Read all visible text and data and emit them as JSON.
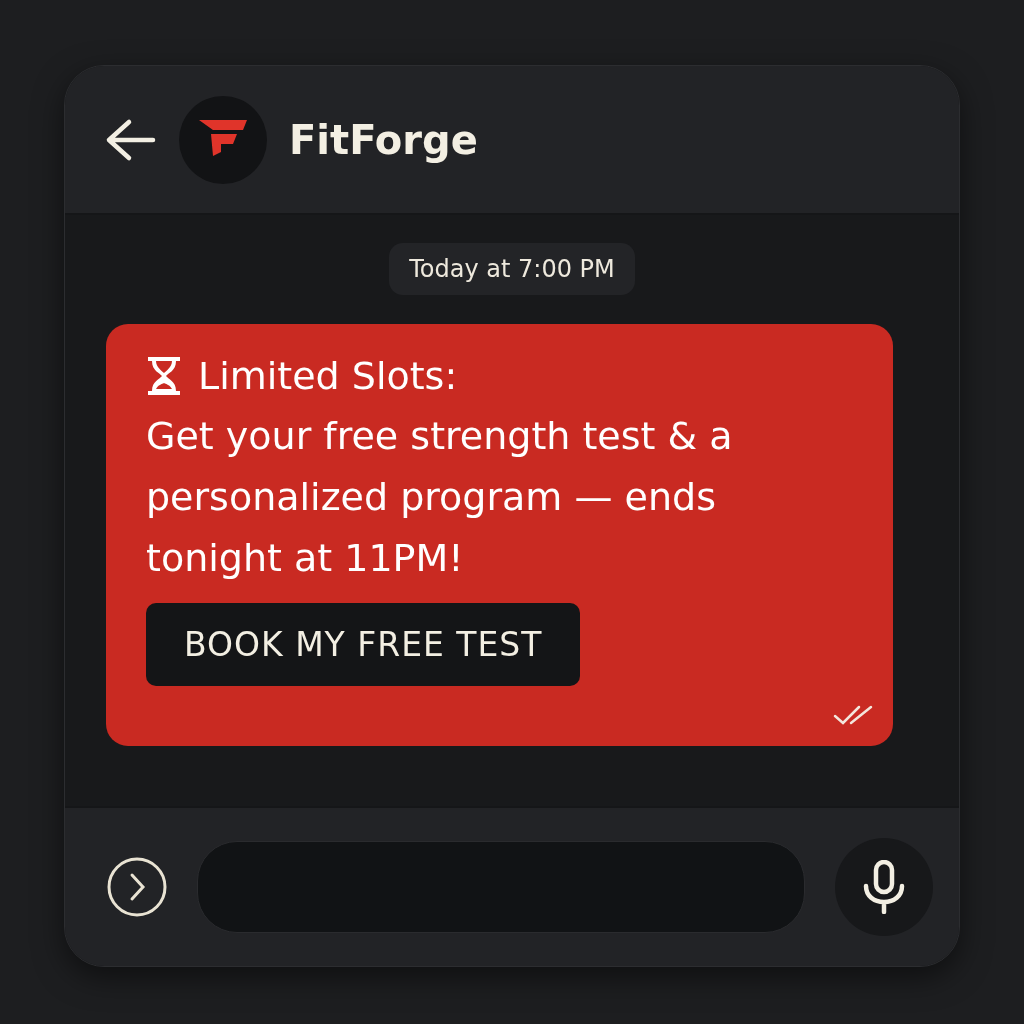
{
  "header": {
    "title": "FitForge"
  },
  "timestamp": "Today at 7:00 PM",
  "message": {
    "heading": "Limited Slots:",
    "body": "Get your free strength test & a personalized program — ends tonight at 11PM!",
    "button": "BOOK MY FREE TEST"
  }
}
